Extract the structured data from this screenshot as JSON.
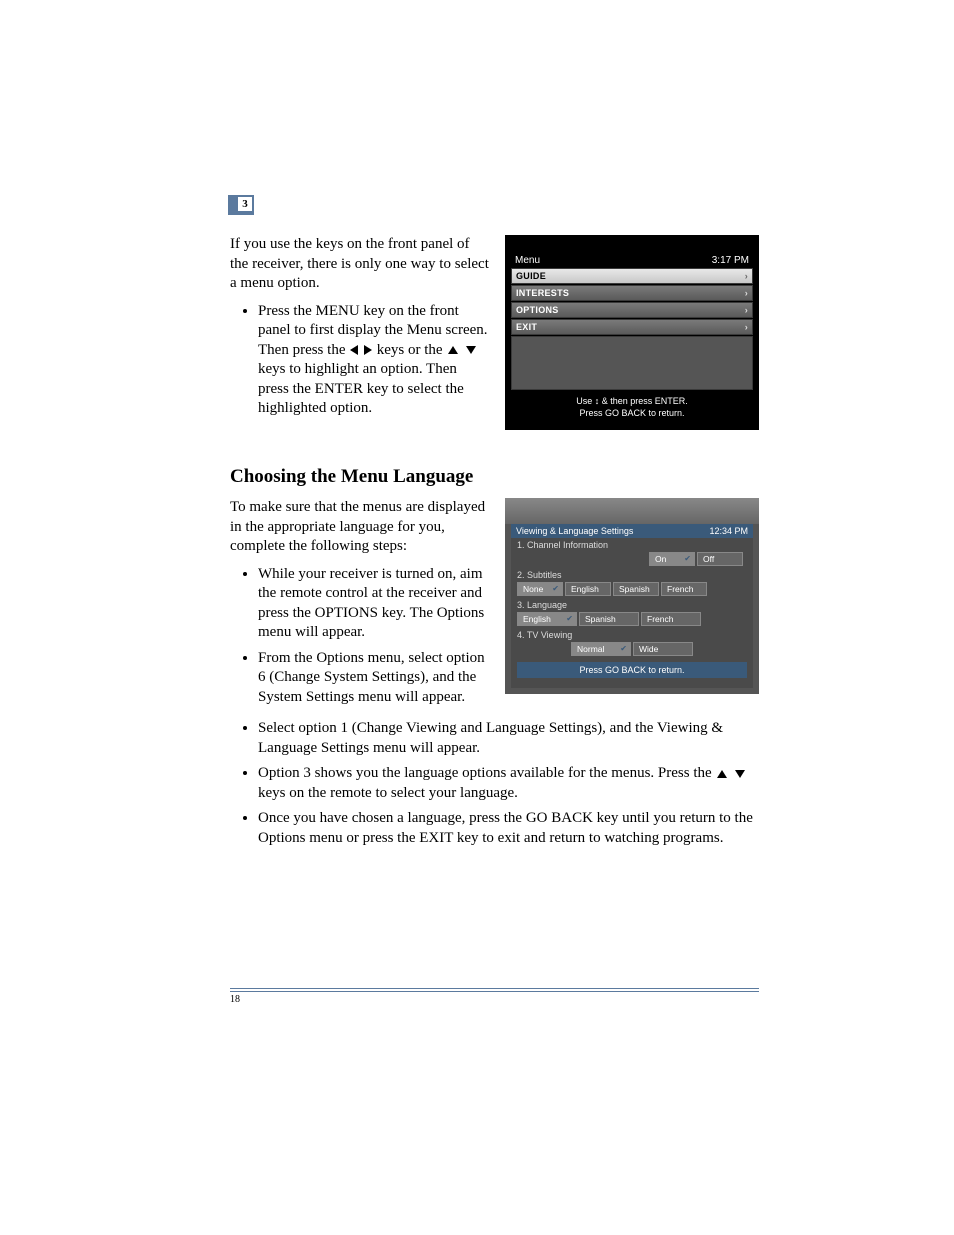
{
  "chapter_number": "3",
  "page_number": "18",
  "section1": {
    "intro": "If you use the keys on the front panel of the receiver, there is only one way to select a menu option.",
    "bullet1_a": "Press the MENU key on the front panel to first display the Menu screen. Then press the ",
    "bullet1_b": " keys or the ",
    "bullet1_c": " keys to highlight an option. Then press the ENTER key to select the highlighted option."
  },
  "osd1": {
    "title": "Menu",
    "time": "3:17 PM",
    "items": [
      "GUIDE",
      "INTERESTS",
      "OPTIONS",
      "EXIT"
    ],
    "hint1": "Use ↕ & then press ENTER.",
    "hint2": "Press GO BACK to return."
  },
  "heading2": "Choosing the Menu Language",
  "section2": {
    "intro": "To make sure that the menus are displayed in the appropriate language for you, complete the following steps:",
    "b1": "While your receiver is turned on, aim the remote control at the receiver and press the OPTIONS key. The Options menu will appear.",
    "b2": "From the Options menu, select option 6 (Change System Settings), and the System Settings menu will appear.",
    "b3": "Select option 1 (Change Viewing and Language Settings), and the Viewing & Language Settings menu will appear.",
    "b4_a": "Option 3 shows you the language options available for the menus. Press the ",
    "b4_b": " keys on the remote to select your language.",
    "b5": "Once you have chosen a language, press the GO BACK key until you return to the Options menu or press the EXIT key to exit and return to watching programs."
  },
  "osd2": {
    "title": "Viewing & Language Settings",
    "time": "12:34 PM",
    "row1_label": "1.  Channel Information",
    "row1_opts": [
      "On",
      "Off"
    ],
    "row2_label": "2.  Subtitles",
    "row2_opts": [
      "None",
      "English",
      "Spanish",
      "French"
    ],
    "row3_label": "3.  Language",
    "row3_opts": [
      "English",
      "Spanish",
      "French"
    ],
    "row4_label": "4.  TV Viewing",
    "row4_opts": [
      "Normal",
      "Wide"
    ],
    "hint": "Press GO BACK to return."
  }
}
